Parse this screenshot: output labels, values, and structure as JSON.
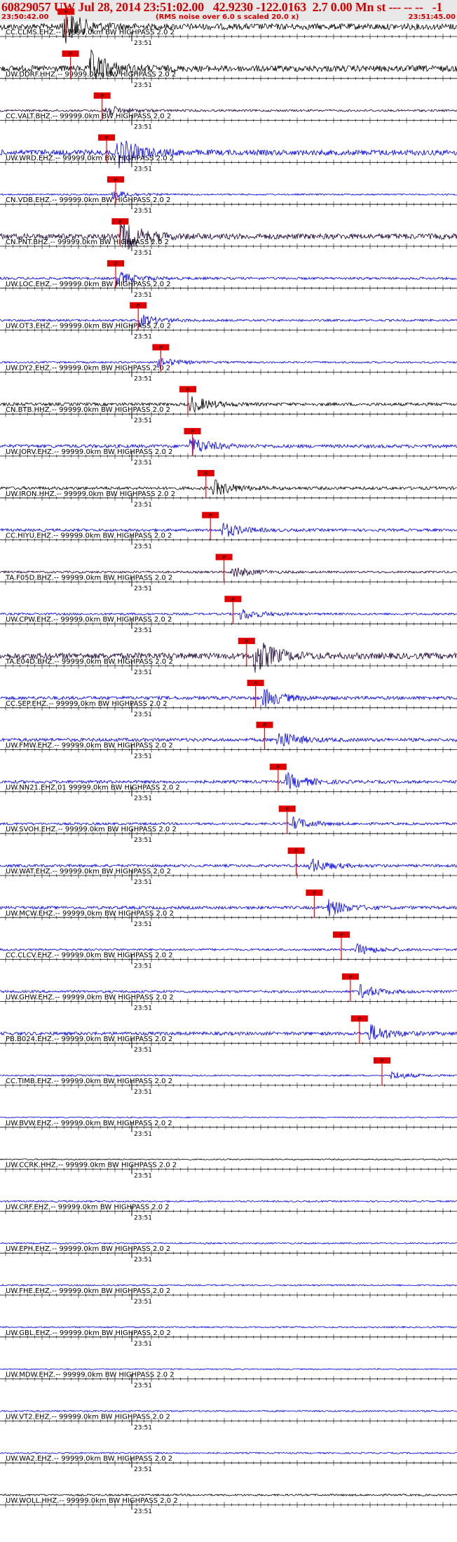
{
  "header": {
    "title": "60829057 UW Jul 28, 2014 23:51:02.00   42.9230 -122.0163  2.7 0.00 Mn st --- -- --   -1",
    "start_time": "23:50:42.00",
    "rms_note": "(RMS noise over 6.0 s scaled 20.0 x)",
    "end_time": "23:51:45.00"
  },
  "minute_label": "23:51",
  "pick_label": "P",
  "colors": {
    "header_text": "#d40000",
    "blue_trace": "#0000ee",
    "dark_trace": "#1a0033",
    "black_trace": "#000000",
    "pick_box": "#e00000",
    "pick_line": "#ff0000"
  },
  "traces": [
    {
      "label": "CC.CLMS.EHZ.-- 99999.0km BW  HIGHPASS  2.0  2",
      "color": "black",
      "pick": 0.14,
      "burst": 0.14,
      "amp": 1.0
    },
    {
      "label": "UW.DDRF.HHZ.-- 99999.0km BW  HIGHPASS  2.0  2",
      "color": "black",
      "pick": 0.15,
      "burst": 0.2,
      "amp": 1.0
    },
    {
      "label": "CC.VALT.BHZ.-- 99999.0km BW  HIGHPASS  2.0  2",
      "color": "dark",
      "pick": 0.22,
      "burst": 0.23,
      "amp": 0.35
    },
    {
      "label": "UW.WRD.EHZ.-- 99999.0km BW  HIGHPASS  2.0  2",
      "color": "blue",
      "pick": 0.23,
      "burst": 0.26,
      "amp": 0.9
    },
    {
      "label": "CN.VDB.EHZ.-- 99999.0km BW  HIGHPASS  2.0  2",
      "color": "blue",
      "pick": 0.25,
      "burst": 0.25,
      "amp": 0.25
    },
    {
      "label": "CN.PNT.BHZ.-- 99999.0km BW  HIGHPASS  2.0  2",
      "color": "dark",
      "pick": 0.26,
      "burst": 0.27,
      "amp": 0.9
    },
    {
      "label": "UW.LOC.EHZ.-- 99999.0km BW  HIGHPASS  2.0  2",
      "color": "blue",
      "pick": 0.25,
      "burst": 0.26,
      "amp": 0.4
    },
    {
      "label": "UW.OT3.EHZ.-- 99999.0km BW  HIGHPASS  2.0  2",
      "color": "blue",
      "pick": 0.3,
      "burst": 0.31,
      "amp": 0.35
    },
    {
      "label": "UW.DY2.EHZ.-- 99999.0km BW  HIGHPASS  2.0  2",
      "color": "blue",
      "pick": 0.35,
      "burst": 0.35,
      "amp": 0.3
    },
    {
      "label": "CN.BTB.HHZ.-- 99999.0km BW  HIGHPASS  2.0  2",
      "color": "black",
      "pick": 0.41,
      "burst": 0.42,
      "amp": 0.5
    },
    {
      "label": "UW.JORV.EHZ.-- 99999.0km BW  HIGHPASS  2.0  2",
      "color": "blue",
      "pick": 0.42,
      "burst": 0.42,
      "amp": 0.55
    },
    {
      "label": "UW.IRON.HHZ.-- 99999.0km BW  HIGHPASS  2.0  2",
      "color": "black",
      "pick": 0.45,
      "burst": 0.47,
      "amp": 0.5
    },
    {
      "label": "CC.HIYU.EHZ.-- 99999.0km BW  HIGHPASS  2.0  2",
      "color": "blue",
      "pick": 0.46,
      "burst": 0.49,
      "amp": 0.45
    },
    {
      "label": "TA.F05D.BHZ.-- 99999.0km BW  HIGHPASS  2.0  2",
      "color": "dark",
      "pick": 0.49,
      "burst": 0.51,
      "amp": 0.35
    },
    {
      "label": "UW.CPW.EHZ.-- 99999.0km BW  HIGHPASS  2.0  2",
      "color": "blue",
      "pick": 0.51,
      "burst": 0.53,
      "amp": 0.35
    },
    {
      "label": "TA.E04D.BHZ.-- 99999.0km BW  HIGHPASS  2.0  2",
      "color": "dark",
      "pick": 0.54,
      "burst": 0.56,
      "amp": 1.0
    },
    {
      "label": "CC.SEP.EHZ.-- 99999.0km BW  HIGHPASS  2.0  2",
      "color": "blue",
      "pick": 0.56,
      "burst": 0.58,
      "amp": 0.55
    },
    {
      "label": "UW.FMW.EHZ.-- 99999.0km BW  HIGHPASS  2.0  2",
      "color": "blue",
      "pick": 0.58,
      "burst": 0.61,
      "amp": 0.55
    },
    {
      "label": "UW.NN21.EHZ.01 99999.0km BW  HIGHPASS  2.0  2",
      "color": "blue",
      "pick": 0.61,
      "burst": 0.63,
      "amp": 0.5
    },
    {
      "label": "UW.SVOH.EHZ.-- 99999.0km BW  HIGHPASS  2.0  2",
      "color": "blue",
      "pick": 0.63,
      "burst": 0.64,
      "amp": 0.4
    },
    {
      "label": "UW.WAT.EHZ.-- 99999.0km BW  HIGHPASS  2.0  2",
      "color": "blue",
      "pick": 0.65,
      "burst": 0.68,
      "amp": 0.45
    },
    {
      "label": "UW.MCW.EHZ.-- 99999.0km BW  HIGHPASS  2.0  2",
      "color": "blue",
      "pick": 0.69,
      "burst": 0.72,
      "amp": 0.5
    },
    {
      "label": "CC.CLCV.EHZ.-- 99999.0km BW  HIGHPASS  2.0  2",
      "color": "blue",
      "pick": 0.75,
      "burst": 0.78,
      "amp": 0.35
    },
    {
      "label": "UW.GHW.EHZ.-- 99999.0km BW  HIGHPASS  2.0  2",
      "color": "blue",
      "pick": 0.77,
      "burst": 0.79,
      "amp": 0.4
    },
    {
      "label": "PB.B024.EHZ.-- 99999.0km BW  HIGHPASS  2.0  2",
      "color": "blue",
      "pick": 0.79,
      "burst": 0.81,
      "amp": 0.55
    },
    {
      "label": "CC.TIMB.EHZ.-- 99999.0km BW  HIGHPASS  2.0  2",
      "color": "blue",
      "pick": 0.84,
      "burst": 0.86,
      "amp": 0.25
    },
    {
      "label": "UW.BVW.EHZ.-- 99999.0km BW  HIGHPASS  2.0  2",
      "color": "blue",
      "pick": null,
      "burst": null,
      "amp": 0.2
    },
    {
      "label": "UW.CCRK.HHZ.-- 99999.0km BW  HIGHPASS  2.0  2",
      "color": "black",
      "pick": null,
      "burst": null,
      "amp": 0.2
    },
    {
      "label": "UW.CRF.EHZ.-- 99999.0km BW  HIGHPASS  2.0  2",
      "color": "blue",
      "pick": null,
      "burst": null,
      "amp": 0.25
    },
    {
      "label": "UW.EPH.EHZ.-- 99999.0km BW  HIGHPASS  2.0  2",
      "color": "blue",
      "pick": null,
      "burst": null,
      "amp": 0.25
    },
    {
      "label": "UW.FHE.EHZ.-- 99999.0km BW  HIGHPASS  2.0  2",
      "color": "blue",
      "pick": null,
      "burst": null,
      "amp": 0.25
    },
    {
      "label": "UW.GBL.EHZ.-- 99999.0km BW  HIGHPASS  2.0  2",
      "color": "blue",
      "pick": null,
      "burst": null,
      "amp": 0.25
    },
    {
      "label": "UW.MDW.EHZ.-- 99999.0km BW  HIGHPASS  2.0  2",
      "color": "blue",
      "pick": null,
      "burst": null,
      "amp": 0.2
    },
    {
      "label": "UW.VT2.EHZ.-- 99999.0km BW  HIGHPASS  2.0  2",
      "color": "blue",
      "pick": null,
      "burst": null,
      "amp": 0.25
    },
    {
      "label": "UW.WA2.EHZ.-- 99999.0km BW  HIGHPASS  2.0  2",
      "color": "blue",
      "pick": null,
      "burst": null,
      "amp": 0.25
    },
    {
      "label": "UW.WOLL.HHZ.-- 99999.0km BW  HIGHPASS  2.0  2",
      "color": "black",
      "pick": null,
      "burst": null,
      "amp": 0.3
    }
  ]
}
